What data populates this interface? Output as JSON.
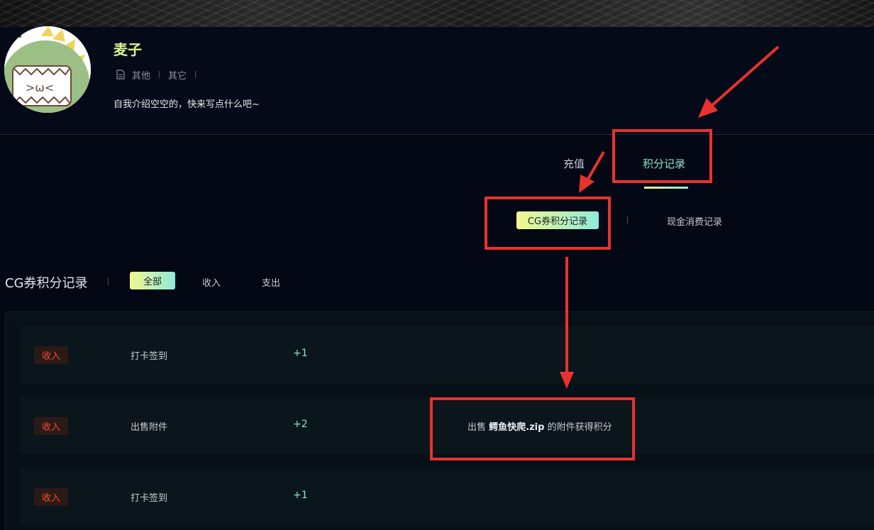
{
  "profile": {
    "username": "麦子",
    "meta": [
      "其他",
      "其它"
    ],
    "bio": "自我介绍空空的，快来写点什么吧~"
  },
  "main_tabs": [
    {
      "label": "充值",
      "active": false
    },
    {
      "label": "积分记录",
      "active": true
    }
  ],
  "sub_tabs": [
    {
      "label": "CG券积分记录",
      "active": true
    },
    {
      "label": "现金消费记录",
      "active": false
    }
  ],
  "section": {
    "title": "CG券积分记录",
    "filters": [
      {
        "label": "全部",
        "active": true
      },
      {
        "label": "收入",
        "active": false
      },
      {
        "label": "支出",
        "active": false
      }
    ]
  },
  "records": [
    {
      "badge": "收入",
      "type": "打卡签到",
      "points": "+1",
      "desc_prefix": "",
      "desc_file": "",
      "desc_suffix": ""
    },
    {
      "badge": "收入",
      "type": "出售附件",
      "points": "+2",
      "desc_prefix": "出售",
      "desc_file": "鳄鱼快爬.zip",
      "desc_suffix": "的附件获得积分"
    },
    {
      "badge": "收入",
      "type": "打卡签到",
      "points": "+1",
      "desc_prefix": "",
      "desc_file": "",
      "desc_suffix": ""
    }
  ],
  "colors": {
    "accent_green": "#8fe3c8",
    "username_yellow_green": "#d7f58f",
    "income_red": "#ef4d2e",
    "annotation_red": "#e8322e",
    "background": "#030814"
  }
}
